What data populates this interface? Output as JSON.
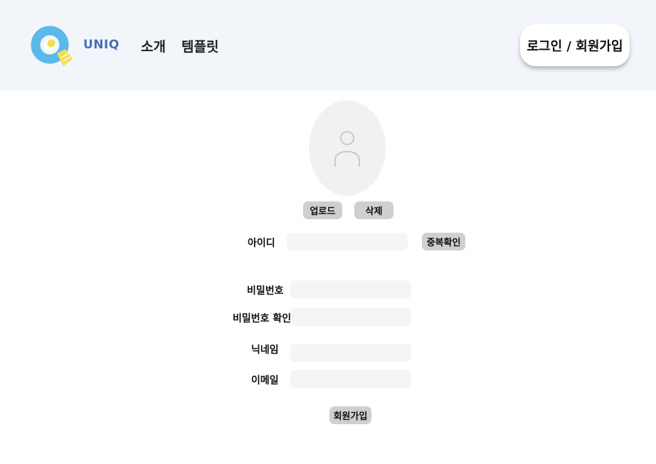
{
  "header": {
    "brand": "UNIQ",
    "nav": {
      "intro": "소개",
      "template": "템플릿"
    },
    "login_signup": "로그인 / 회원가입"
  },
  "profile": {
    "avatar_icon": "user-icon",
    "upload_label": "업로드",
    "delete_label": "삭제"
  },
  "form": {
    "id_label": "아이디",
    "id_value": "",
    "duplicate_check_label": "중복확인",
    "password_label": "비밀번호",
    "password_value": "",
    "password_confirm_label": "비밀번호 확인",
    "password_confirm_value": "",
    "nickname_label": "닉네임",
    "nickname_value": "",
    "email_label": "이메일",
    "email_value": "",
    "submit_label": "회원가입"
  },
  "colors": {
    "header_bg": "#f2f5fa",
    "brand": "#4a6fb8",
    "logo_blue": "#5bb8ea",
    "logo_yellow": "#f3df52",
    "button_gray": "#cfcfcf",
    "input_bg": "#f5f5f5"
  }
}
